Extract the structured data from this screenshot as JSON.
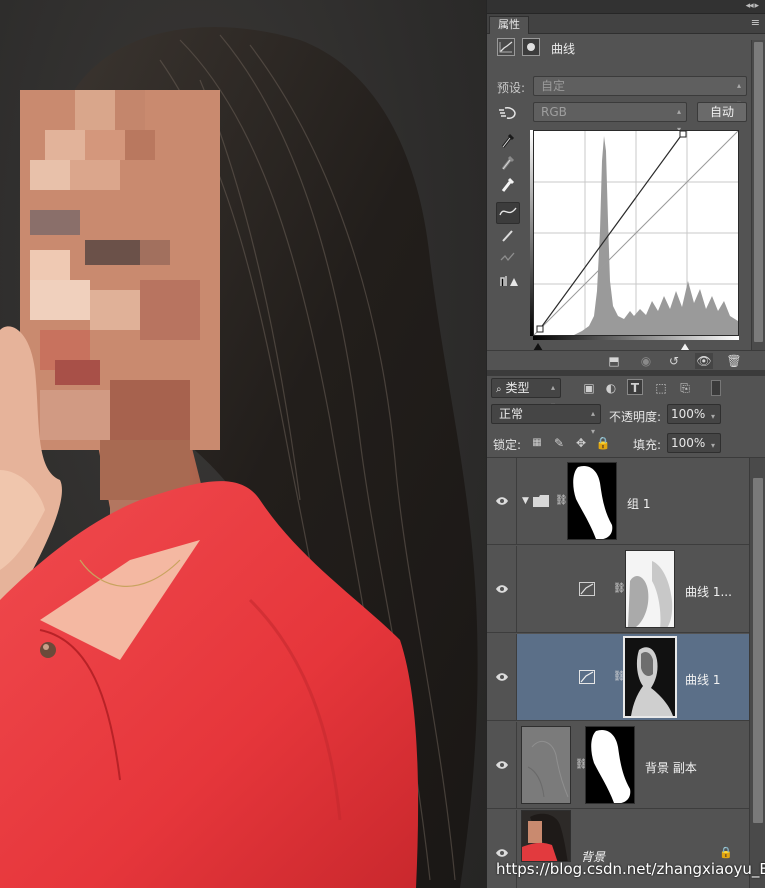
{
  "properties_panel": {
    "tab_label": "属性",
    "title": "曲线",
    "preset_label": "预设:",
    "preset_value": "自定",
    "channel_value": "RGB",
    "auto_button": "自动"
  },
  "layers_panel": {
    "filter_kind": "类型",
    "blend_mode": "正常",
    "opacity_label": "不透明度:",
    "opacity_value": "100%",
    "lock_label": "锁定:",
    "fill_label": "填充:",
    "fill_value": "100%",
    "layers": [
      {
        "name": "组 1",
        "type": "group",
        "selected": false
      },
      {
        "name": "曲线 1...",
        "type": "curves",
        "selected": false
      },
      {
        "name": "曲线 1",
        "type": "curves",
        "selected": true
      },
      {
        "name": "背景 副本",
        "type": "pixel",
        "selected": false
      },
      {
        "name": "背景",
        "type": "background",
        "selected": false
      }
    ]
  },
  "watermark": "https://blog.csdn.net/zhangxiaoyu_BK",
  "colors": {
    "panel_bg": "#535353",
    "selected_layer": "#5b6f88",
    "shirt_red": "#e8343a",
    "hair": "#2a2522"
  }
}
